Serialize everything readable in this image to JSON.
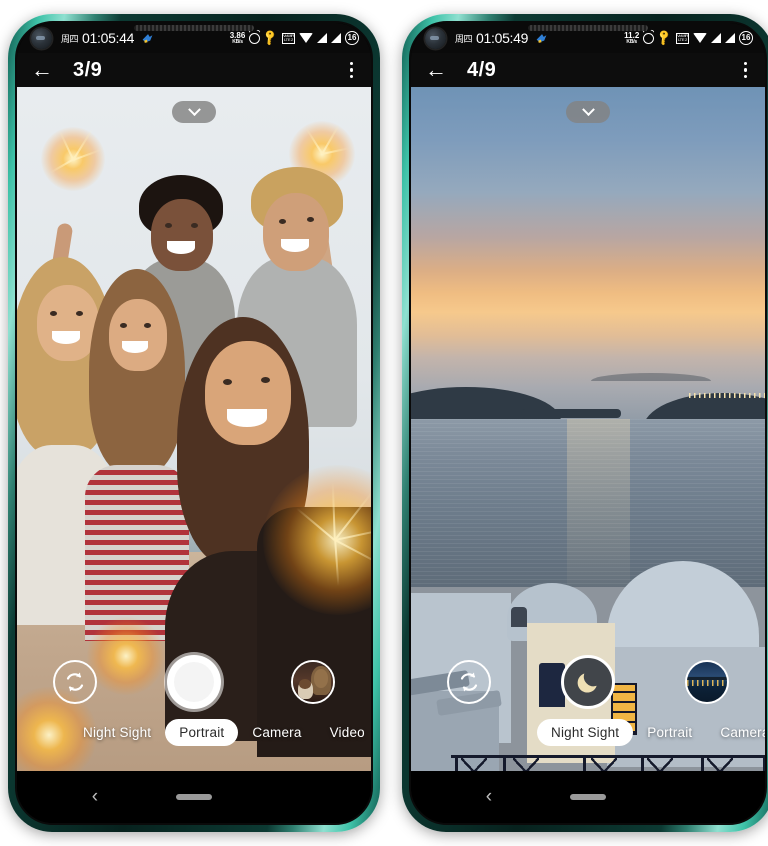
{
  "phones": [
    {
      "id": "phone-left",
      "status_bar": {
        "weekday": "周四",
        "time": "01:05:44",
        "net_speed_value": "3.86",
        "net_speed_unit": "KB/s",
        "alarm_icon": "alarm-icon",
        "key_icon": "vpn-key-icon",
        "volte_icon": "volte-wifi-icon",
        "volte_line1": "VoWiFi",
        "volte_line2": "LTE 2",
        "wifi_icon": "wifi-icon",
        "signal_icon": "signal-bars-icon",
        "battery_level": "16"
      },
      "app_bar": {
        "back_icon": "back-arrow-icon",
        "page_indicator": "3/9",
        "overflow_icon": "more-vert-icon"
      },
      "viewfinder": {
        "collapse_icon": "chevron-down-icon",
        "scene": "group-selfie-sparklers"
      },
      "controls": {
        "flip_icon": "camera-flip-icon",
        "shutter_icon": "shutter-button",
        "shutter_style": "photo",
        "thumbnail_icon": "gallery-thumbnail",
        "thumbnail_scene": "woman-with-dog"
      },
      "modes": [
        {
          "label": "Night Sight",
          "active": false
        },
        {
          "label": "Portrait",
          "active": true
        },
        {
          "label": "Camera",
          "active": false
        },
        {
          "label": "Video",
          "active": false
        }
      ],
      "nav_bar": {
        "back_icon": "nav-back-icon",
        "home_icon": "nav-home-pill"
      }
    },
    {
      "id": "phone-right",
      "status_bar": {
        "weekday": "周四",
        "time": "01:05:49",
        "net_speed_value": "11.2",
        "net_speed_unit": "KB/s",
        "alarm_icon": "alarm-icon",
        "key_icon": "vpn-key-icon",
        "volte_icon": "volte-wifi-icon",
        "volte_line1": "VoWiFi",
        "volte_line2": "LTE 2",
        "wifi_icon": "wifi-icon",
        "signal_icon": "signal-bars-icon",
        "battery_level": "16"
      },
      "app_bar": {
        "back_icon": "back-arrow-icon",
        "page_indicator": "4/9",
        "overflow_icon": "more-vert-icon"
      },
      "viewfinder": {
        "collapse_icon": "chevron-down-icon",
        "scene": "santorini-sunset-seascape"
      },
      "controls": {
        "flip_icon": "camera-flip-icon",
        "shutter_icon": "night-sight-shutter",
        "shutter_style": "night",
        "thumbnail_icon": "gallery-thumbnail",
        "thumbnail_scene": "night-cityscape"
      },
      "modes": [
        {
          "label": "Night Sight",
          "active": true
        },
        {
          "label": "Portrait",
          "active": false
        },
        {
          "label": "Camera",
          "active": false
        }
      ],
      "nav_bar": {
        "back_icon": "nav-back-icon",
        "home_icon": "nav-home-pill"
      }
    }
  ],
  "colors": {
    "frame_teal": "#2f7f70",
    "status_bar_bg": "#0a0a0a",
    "app_bar_bg": "#0d0d0d",
    "mode_active_bg": "#ffffff",
    "mode_active_text": "#2b2b2b",
    "night_shutter_bg": "#41454a",
    "moon_color": "#efe0b4",
    "page_bg": "#ffffff"
  }
}
